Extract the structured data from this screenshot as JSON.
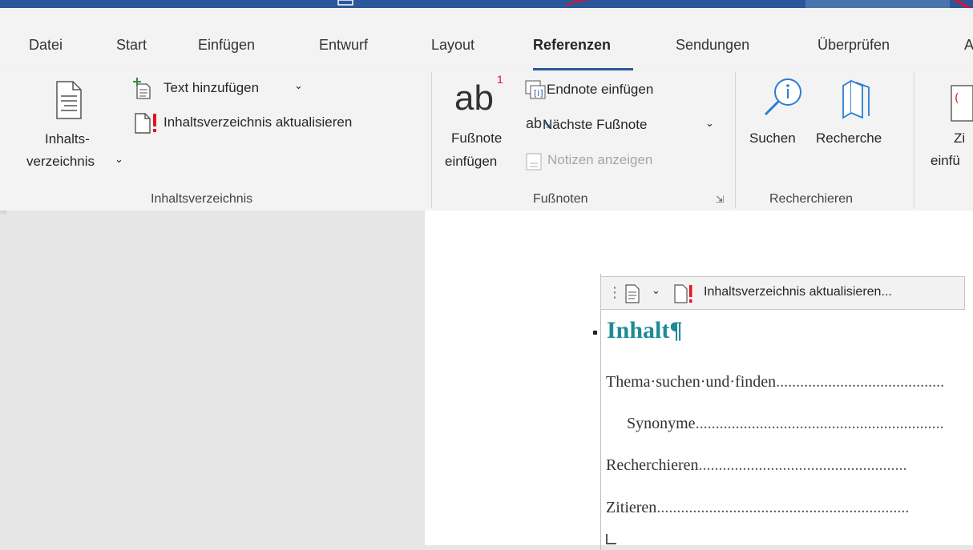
{
  "tabs": [
    "Datei",
    "Start",
    "Einfügen",
    "Entwurf",
    "Layout",
    "Referenzen",
    "Sendungen",
    "Überprüfen",
    "A"
  ],
  "active_tab": "Referenzen",
  "ribbon": {
    "toc_group": {
      "toc_button_line1": "Inhalts-",
      "toc_button_line2": "verzeichnis",
      "add_text": "Text hinzufügen",
      "update_toc": "Inhaltsverzeichnis aktualisieren",
      "label": "Inhaltsverzeichnis"
    },
    "footnotes_group": {
      "insert_line1": "Fußnote",
      "insert_line2": "einfügen",
      "insert_endnote": "Endnote einfügen",
      "next_footnote": "Nächste Fußnote",
      "show_notes": "Notizen anzeigen",
      "label": "Fußnoten"
    },
    "research_group": {
      "search": "Suchen",
      "research": "Recherche",
      "label": "Recherchieren"
    },
    "citations_group": {
      "insert_line1": "Zi",
      "insert_line2": "einfü"
    }
  },
  "document": {
    "toc_toolbar_update": "Inhaltsverzeichnis aktualisieren...",
    "toc_heading": "Inhalt¶",
    "toc_entries": [
      {
        "text": "Thema·suchen·und·finden",
        "dots": ".........................................."
      },
      {
        "text": "Synonyme",
        "dots": ".............................................................."
      },
      {
        "text": "Recherchieren",
        "dots": "...................................................."
      },
      {
        "text": "Zitieren",
        "dots": "..............................................................."
      }
    ]
  },
  "colors": {
    "accent": "#2b579a",
    "heading": "#1f8a98",
    "alert_red": "#e81123"
  }
}
